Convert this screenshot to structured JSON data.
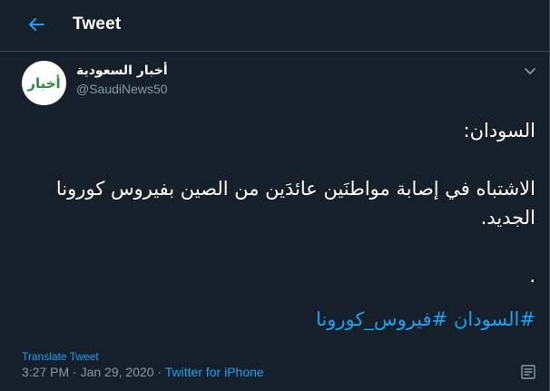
{
  "header": {
    "title": "Tweet",
    "back_icon": "arrow-left-icon"
  },
  "author": {
    "display_name": "أخبار السعودية",
    "handle": "@SaudiNews50",
    "avatar_text": "أخبار"
  },
  "tweet": {
    "line1": "السودان:",
    "line2": "الاشتباه في إصابة مواطنَين عائدَين من الصين بفيروس كورونا الجديد.",
    "line3": ".",
    "hashtag1": "#السودان",
    "hashtag2": "#فيروس_كورونا"
  },
  "translate_label": "Translate Tweet",
  "meta": {
    "time": "3:27 PM",
    "separator1": " · ",
    "date": "Jan 29, 2020",
    "separator2": " · ",
    "source": "Twitter for iPhone"
  },
  "colors": {
    "background": "#15202b",
    "accent": "#1da1f2",
    "secondary_text": "#8899a6",
    "border": "#38444d"
  }
}
